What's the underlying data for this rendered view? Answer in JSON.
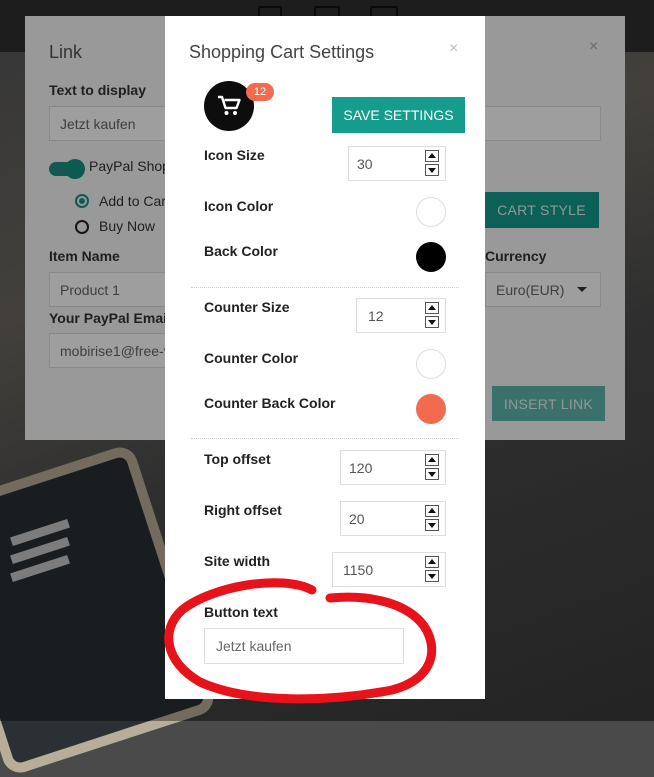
{
  "link_dialog": {
    "title": "Link",
    "text_to_display_label": "Text to display",
    "text_to_display_value": "Jetzt kaufen",
    "paypal_toggle_label": "PayPal Shop",
    "option_add_to_cart": "Add to Car",
    "option_buy_now": "Buy Now",
    "item_name_label": "Item Name",
    "item_name_value": "Product 1",
    "paypal_email_label": "Your PayPal Email",
    "paypal_email_value": "mobirise1@free-v",
    "cart_style_button": "CART STYLE",
    "currency_label": "Currency",
    "currency_value": "Euro(EUR)",
    "insert_link_button": "INSERT LINK"
  },
  "settings_modal": {
    "title": "Shopping Cart Settings",
    "close": "×",
    "badge_count": "12",
    "save_button": "SAVE SETTINGS",
    "icon_size": {
      "label": "Icon Size",
      "value": "30"
    },
    "icon_color": {
      "label": "Icon Color",
      "color": "#ffffff"
    },
    "back_color": {
      "label": "Back Color",
      "color": "#000000"
    },
    "counter_size": {
      "label": "Counter Size",
      "value": "12"
    },
    "counter_color": {
      "label": "Counter Color",
      "color": "#ffffff"
    },
    "counter_back_color": {
      "label": "Counter Back Color",
      "color": "#f26b4f"
    },
    "top_offset": {
      "label": "Top offset",
      "value": "120"
    },
    "right_offset": {
      "label": "Right offset",
      "value": "20"
    },
    "site_width": {
      "label": "Site width",
      "value": "1150"
    },
    "button_text": {
      "label": "Button text",
      "value": "Jetzt kaufen"
    }
  },
  "colors": {
    "accent": "#159c8d",
    "badge": "#f26b4f",
    "annotation": "#e8121b"
  },
  "link_dialog_close": "×"
}
